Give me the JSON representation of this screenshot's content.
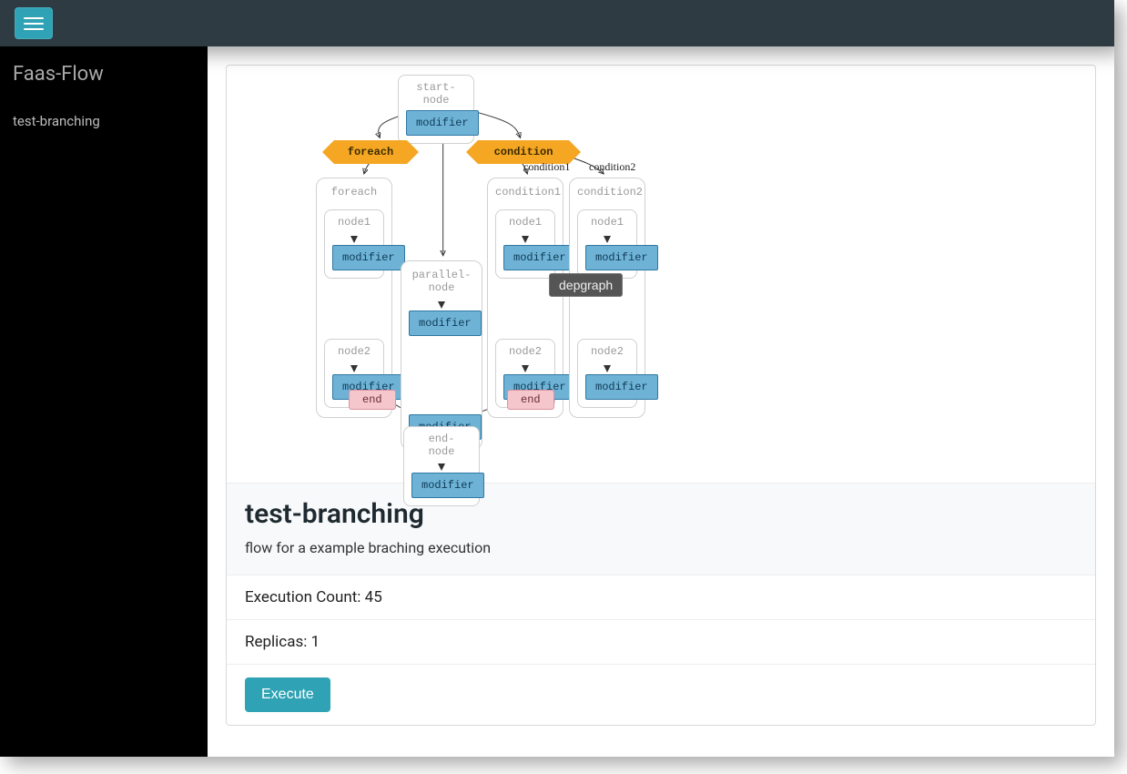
{
  "topbar": {
    "menu_icon": "hamburger-icon"
  },
  "sidebar": {
    "brand": "Faas-Flow",
    "items": [
      {
        "label": "test-branching"
      }
    ]
  },
  "graph": {
    "tooltip": "depgraph",
    "start": {
      "title": "start-node",
      "op": "modifier"
    },
    "foreach": {
      "label": "foreach"
    },
    "condition": {
      "label": "condition"
    },
    "edge_labels": {
      "cond1": "condition1",
      "cond2": "condition2"
    },
    "foreach_sub": {
      "title": "foreach",
      "node1": {
        "title": "node1",
        "op": "modifier"
      },
      "node2": {
        "title": "node2",
        "op": "modifier"
      }
    },
    "parallel": {
      "title": "parallel-node",
      "op": "modifier",
      "op2": "modifier"
    },
    "cond1_sub": {
      "title": "condition1",
      "node1": {
        "title": "node1",
        "op": "modifier"
      },
      "node2": {
        "title": "node2",
        "op": "modifier"
      }
    },
    "cond2_sub": {
      "title": "condition2",
      "node1": {
        "title": "node1",
        "op": "modifier"
      },
      "node2": {
        "title": "node2",
        "op": "modifier"
      }
    },
    "end_foreach": "end",
    "end_cond": "end",
    "end_node": {
      "title": "end-node",
      "op": "modifier"
    }
  },
  "flow": {
    "title": "test-branching",
    "description": "flow for a example braching execution",
    "exec_label": "Execution Count: ",
    "exec_value": "45",
    "replicas_label": "Replicas: ",
    "replicas_value": "1",
    "execute_label": "Execute"
  }
}
